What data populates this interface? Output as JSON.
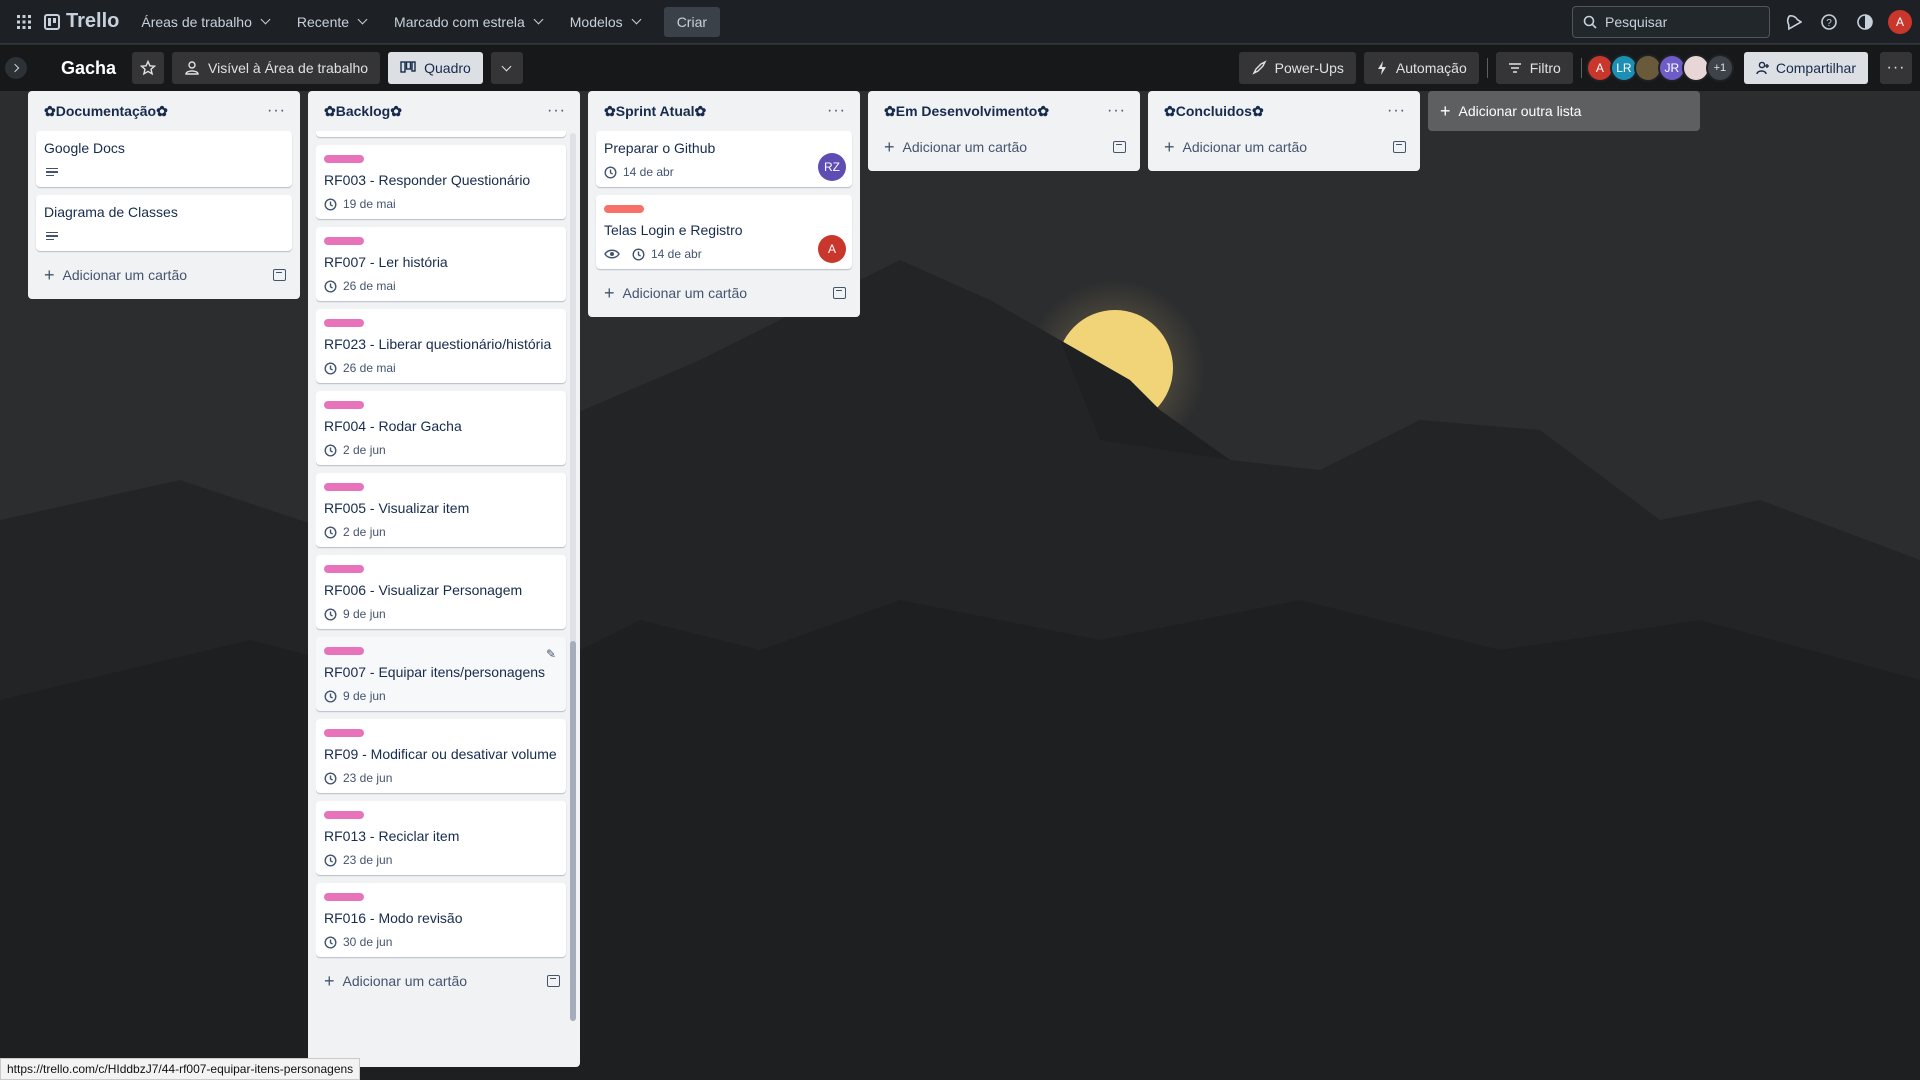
{
  "nav": {
    "logo": "Trello",
    "menu": [
      {
        "label": "Áreas de trabalho"
      },
      {
        "label": "Recente"
      },
      {
        "label": "Marcado com estrela"
      },
      {
        "label": "Modelos"
      }
    ],
    "create_label": "Criar",
    "search_placeholder": "Pesquisar",
    "user_initial": "A"
  },
  "board": {
    "title": "Gacha",
    "visibility_label": "Visível à Área de trabalho",
    "view_label": "Quadro",
    "powerups_label": "Power-Ups",
    "automation_label": "Automação",
    "filter_label": "Filtro",
    "share_label": "Compartilhar",
    "members": [
      {
        "initials": "A",
        "color": "#c9372c"
      },
      {
        "initials": "LR",
        "color": "#1d8fb5"
      },
      {
        "initials": "",
        "color": "#6a5a3c"
      },
      {
        "initials": "JR",
        "color": "#6e5dc6"
      },
      {
        "initials": "",
        "color": "#e8d6d6"
      }
    ],
    "members_more": "+1"
  },
  "lists": {
    "documentacao": {
      "title": "✿Documentação✿",
      "cards": [
        {
          "title": "Google Docs"
        },
        {
          "title": "Diagrama de Classes"
        }
      ],
      "add_label": "Adicionar um cartão"
    },
    "backlog": {
      "title": "✿Backlog✿",
      "label_color": "#e774bb",
      "cards": [
        {
          "title": "RF003 - Responder Questionário",
          "date": "19 de mai"
        },
        {
          "title": "RF007 - Ler história",
          "date": "26 de mai"
        },
        {
          "title": "RF023 - Liberar questionário/história",
          "date": "26 de mai"
        },
        {
          "title": "RF004 - Rodar Gacha",
          "date": "2 de jun"
        },
        {
          "title": "RF005 - Visualizar item",
          "date": "2 de jun"
        },
        {
          "title": "RF006 - Visualizar Personagem",
          "date": "9 de jun"
        },
        {
          "title": "RF007 - Equipar itens/personagens",
          "date": "9 de jun"
        },
        {
          "title": "RF09 - Modificar ou desativar volume",
          "date": "23 de jun"
        },
        {
          "title": "RF013 - Reciclar item",
          "date": "23 de jun"
        },
        {
          "title": "RF016 - Modo revisão",
          "date": "30 de jun"
        }
      ],
      "add_label": "Adicionar um cartão"
    },
    "sprint": {
      "title": "✿Sprint Atual✿",
      "cards": [
        {
          "title": "Preparar o Github",
          "date": "14 de abr",
          "member": "RZ",
          "member_color": "#5e4db2"
        },
        {
          "title": "Telas Login e Registro",
          "date": "14 de abr",
          "member": "A",
          "member_color": "#c9372c",
          "label_color": "#f87168"
        }
      ],
      "add_label": "Adicionar um cartão"
    },
    "dev": {
      "title": "✿Em Desenvolvimento✿",
      "add_label": "Adicionar um cartão"
    },
    "done": {
      "title": "✿Concluidos✿",
      "add_label": "Adicionar um cartão"
    }
  },
  "add_list_label": "Adicionar outra lista",
  "status_url": "https://trello.com/c/HIddbzJ7/44-rf007-equipar-itens-personagens"
}
